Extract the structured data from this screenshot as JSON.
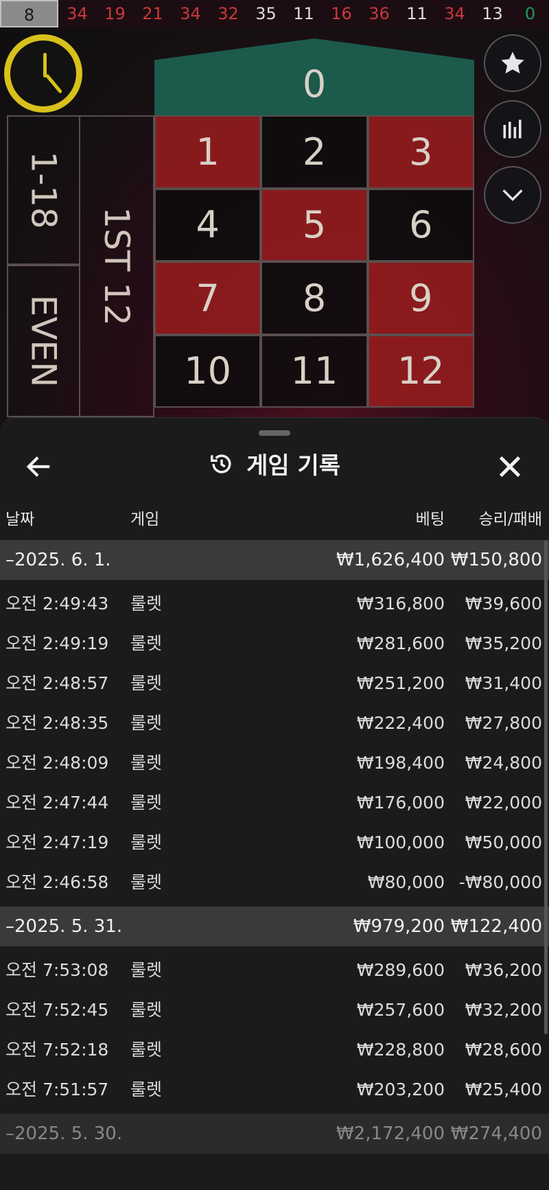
{
  "recent_numbers": [
    {
      "n": "8",
      "color": "first"
    },
    {
      "n": "34",
      "color": "red"
    },
    {
      "n": "19",
      "color": "red"
    },
    {
      "n": "21",
      "color": "red"
    },
    {
      "n": "34",
      "color": "red"
    },
    {
      "n": "32",
      "color": "red"
    },
    {
      "n": "35",
      "color": "black"
    },
    {
      "n": "11",
      "color": "black"
    },
    {
      "n": "16",
      "color": "red"
    },
    {
      "n": "36",
      "color": "red"
    },
    {
      "n": "11",
      "color": "black"
    },
    {
      "n": "34",
      "color": "red"
    },
    {
      "n": "13",
      "color": "black"
    },
    {
      "n": "0",
      "color": "green"
    }
  ],
  "board": {
    "zero": "0",
    "cells": [
      {
        "n": "1",
        "color": "red"
      },
      {
        "n": "2",
        "color": "black"
      },
      {
        "n": "3",
        "color": "red"
      },
      {
        "n": "4",
        "color": "black"
      },
      {
        "n": "5",
        "color": "red"
      },
      {
        "n": "6",
        "color": "black"
      },
      {
        "n": "7",
        "color": "red"
      },
      {
        "n": "8",
        "color": "black"
      },
      {
        "n": "9",
        "color": "red"
      },
      {
        "n": "10",
        "color": "black"
      },
      {
        "n": "11",
        "color": "black"
      },
      {
        "n": "12",
        "color": "red"
      }
    ],
    "outside_low": "1-18",
    "outside_even": "EVEN",
    "outside_dozen": "1ST 12"
  },
  "side_buttons": [
    "star-icon",
    "stats-icon",
    "chevron-down-icon"
  ],
  "sheet": {
    "title": "게임 기록",
    "columns": {
      "date": "날짜",
      "game": "게임",
      "bet": "베팅",
      "win_loss": "승리/패배"
    },
    "groups": [
      {
        "date": "–2025. 6. 1.",
        "bet": "₩1,626,400",
        "win_loss": "₩150,800",
        "faded": false,
        "records": [
          {
            "time": "오전 2:49:43",
            "game": "룰렛",
            "bet": "₩316,800",
            "win_loss": "₩39,600"
          },
          {
            "time": "오전 2:49:19",
            "game": "룰렛",
            "bet": "₩281,600",
            "win_loss": "₩35,200"
          },
          {
            "time": "오전 2:48:57",
            "game": "룰렛",
            "bet": "₩251,200",
            "win_loss": "₩31,400"
          },
          {
            "time": "오전 2:48:35",
            "game": "룰렛",
            "bet": "₩222,400",
            "win_loss": "₩27,800"
          },
          {
            "time": "오전 2:48:09",
            "game": "룰렛",
            "bet": "₩198,400",
            "win_loss": "₩24,800"
          },
          {
            "time": "오전 2:47:44",
            "game": "룰렛",
            "bet": "₩176,000",
            "win_loss": "₩22,000"
          },
          {
            "time": "오전 2:47:19",
            "game": "룰렛",
            "bet": "₩100,000",
            "win_loss": "₩50,000"
          },
          {
            "time": "오전 2:46:58",
            "game": "룰렛",
            "bet": "₩80,000",
            "win_loss": "-₩80,000"
          }
        ]
      },
      {
        "date": "–2025. 5. 31.",
        "bet": "₩979,200",
        "win_loss": "₩122,400",
        "faded": false,
        "records": [
          {
            "time": "오전 7:53:08",
            "game": "룰렛",
            "bet": "₩289,600",
            "win_loss": "₩36,200"
          },
          {
            "time": "오전 7:52:45",
            "game": "룰렛",
            "bet": "₩257,600",
            "win_loss": "₩32,200"
          },
          {
            "time": "오전 7:52:18",
            "game": "룰렛",
            "bet": "₩228,800",
            "win_loss": "₩28,600"
          },
          {
            "time": "오전 7:51:57",
            "game": "룰렛",
            "bet": "₩203,200",
            "win_loss": "₩25,400"
          }
        ]
      },
      {
        "date": "–2025. 5. 30.",
        "bet": "₩2,172,400",
        "win_loss": "₩274,400",
        "faded": true,
        "records": []
      }
    ]
  }
}
